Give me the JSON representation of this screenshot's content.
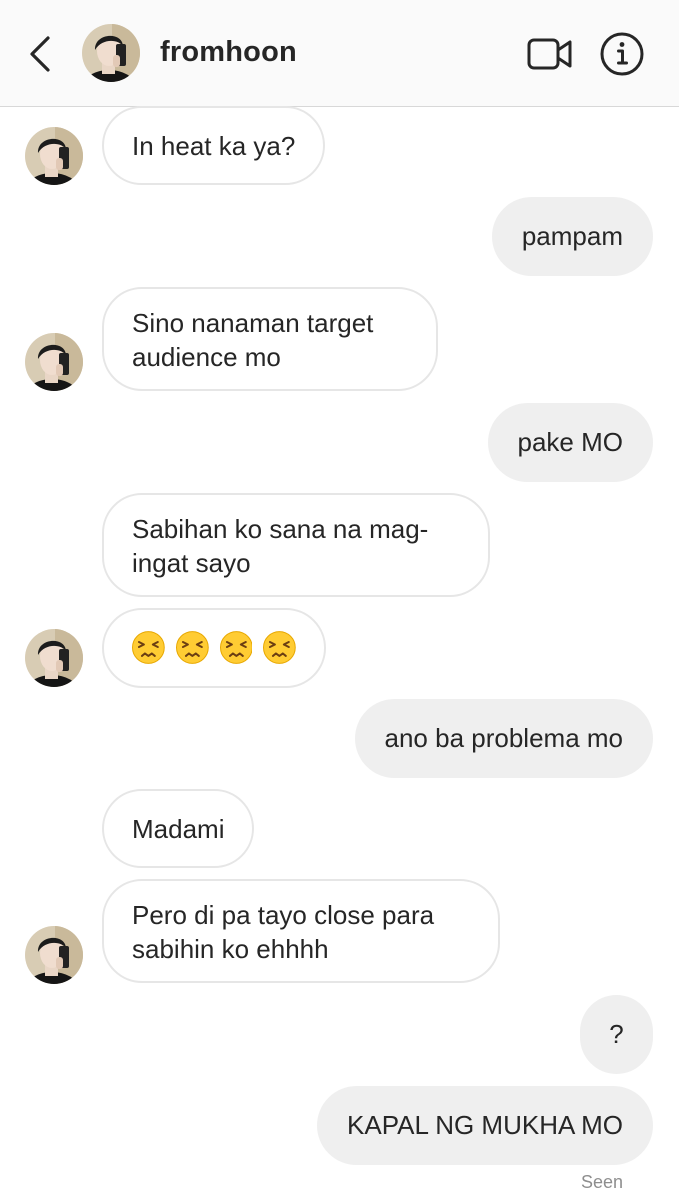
{
  "header": {
    "username": "fromhoon",
    "back_icon": "chevron-left-icon",
    "video_icon": "video-call-icon",
    "info_icon": "info-icon"
  },
  "messages": [
    {
      "sender": "them",
      "lines": [
        "In heat ka ya?"
      ]
    },
    {
      "sender": "me",
      "lines": [
        "pampam"
      ]
    },
    {
      "sender": "them",
      "lines": [
        "Sino nanaman target",
        "audience mo"
      ]
    },
    {
      "sender": "me",
      "lines": [
        "pake MO"
      ]
    },
    {
      "sender": "them",
      "lines": [
        "Sabihan ko sana na mag-",
        "ingat sayo"
      ]
    },
    {
      "sender": "them",
      "emoji": "persevering-face",
      "emoji_count": 4
    },
    {
      "sender": "me",
      "lines": [
        "ano ba problema mo"
      ]
    },
    {
      "sender": "them",
      "lines": [
        "Madami"
      ]
    },
    {
      "sender": "them",
      "lines": [
        "Pero di pa tayo close para",
        "sabihin ko ehhhh"
      ]
    },
    {
      "sender": "me",
      "lines": [
        "?"
      ]
    },
    {
      "sender": "me",
      "lines": [
        "KAPAL NG MUKHA MO"
      ]
    }
  ],
  "status": {
    "seen": "Seen"
  },
  "colors": {
    "header_bg": "#fafafa",
    "incoming_bubble_border": "#e6e6e6",
    "outgoing_bubble_bg": "#efefef",
    "text": "#262626",
    "muted": "#8e8e8e"
  }
}
